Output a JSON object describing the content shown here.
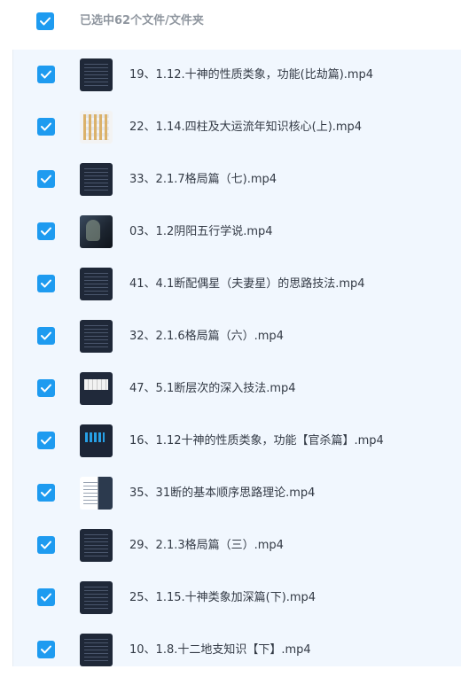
{
  "header": {
    "selected_label": "已选中62个文件/文件夹",
    "select_all_checked": true
  },
  "files": [
    {
      "name": "19、1.12.十神的性质类象，功能(比劫篇).mp4",
      "thumb": "dark"
    },
    {
      "name": "22、1.14.四柱及大运流年知识核心(上).mp4",
      "thumb": "grid"
    },
    {
      "name": "33、2.1.7格局篇（七).mp4",
      "thumb": "dark"
    },
    {
      "name": "03、1.2阴阳五行学说.mp4",
      "thumb": "photo"
    },
    {
      "name": "41、4.1断配偶星（夫妻星）的思路技法.mp4",
      "thumb": "dark"
    },
    {
      "name": "32、2.1.6格局篇（六）.mp4",
      "thumb": "dark"
    },
    {
      "name": "47、5.1断层次的深入技法.mp4",
      "thumb": "light"
    },
    {
      "name": "16、1.12十神的性质类象，功能【官杀篇】.mp4",
      "thumb": "blue"
    },
    {
      "name": "35、31断的基本顺序思路理论.mp4",
      "thumb": "split"
    },
    {
      "name": "29、2.1.3格局篇（三）.mp4",
      "thumb": "dark"
    },
    {
      "name": "25、1.15.十神类象加深篇(下).mp4",
      "thumb": "dark"
    },
    {
      "name": "10、1.8.十二地支知识【下】.mp4",
      "thumb": "dark"
    }
  ],
  "colors": {
    "accent": "#1e9bf0",
    "list_bg": "#f1f7fe",
    "text": "#333a45",
    "muted": "#8f969f"
  }
}
